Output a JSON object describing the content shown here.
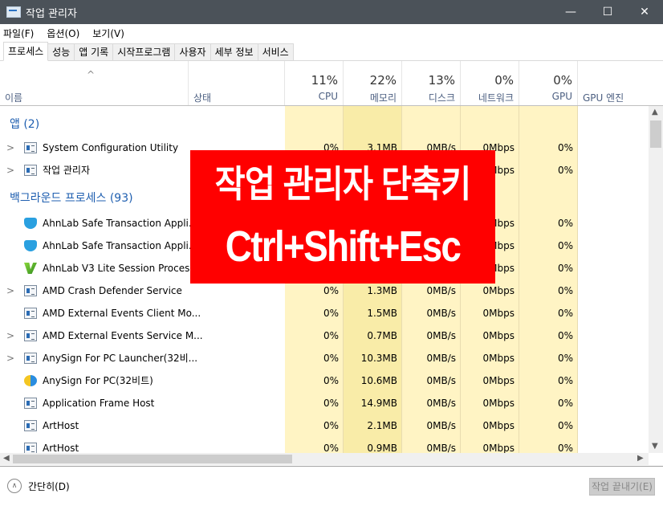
{
  "window": {
    "title": "작업 관리자",
    "minimize": "—",
    "maximize": "☐",
    "close": "✕"
  },
  "menu": [
    "파일(F)",
    "옵션(O)",
    "보기(V)"
  ],
  "tabs": [
    "프로세스",
    "성능",
    "앱 기록",
    "시작프로그램",
    "사용자",
    "세부 정보",
    "서비스"
  ],
  "active_tab": "프로세스",
  "columns": {
    "name": "이름",
    "status": "상태",
    "cpu": {
      "pct": "11%",
      "label": "CPU"
    },
    "memory": {
      "pct": "22%",
      "label": "메모리"
    },
    "disk": {
      "pct": "13%",
      "label": "디스크"
    },
    "network": {
      "pct": "0%",
      "label": "네트워크"
    },
    "gpu": {
      "pct": "0%",
      "label": "GPU"
    },
    "gpu_engine": "GPU 엔진"
  },
  "groups": {
    "apps": "앱 (2)",
    "background": "백그라운드 프로세스 (93)"
  },
  "rows": [
    {
      "name": "System Configuration Utility",
      "icon": "msconfig-icon",
      "expand": true,
      "cpu": "0%",
      "mem": "3.1MB",
      "disk": "0MB/s",
      "net": "0Mbps",
      "gpu": "0%"
    },
    {
      "name": "작업 관리자",
      "icon": "task-manager-icon",
      "expand": true,
      "cpu": "",
      "mem": "",
      "disk": "",
      "net": "Mbps",
      "gpu": "0%"
    },
    {
      "name": "AhnLab Safe Transaction Appli...",
      "icon": "shield-icon",
      "expand": false,
      "cpu": "",
      "mem": "",
      "disk": "",
      "net": "Mbps",
      "gpu": "0%"
    },
    {
      "name": "AhnLab Safe Transaction Appli...",
      "icon": "shield-icon",
      "expand": false,
      "cpu": "",
      "mem": "",
      "disk": "",
      "net": "Mbps",
      "gpu": "0%"
    },
    {
      "name": "AhnLab V3 Lite Session Proces...",
      "icon": "v3-icon",
      "expand": false,
      "cpu": "",
      "mem": "",
      "disk": "",
      "net": "Mbps",
      "gpu": "0%"
    },
    {
      "name": "AMD Crash Defender Service",
      "icon": "service-icon",
      "expand": true,
      "cpu": "0%",
      "mem": "1.3MB",
      "disk": "0MB/s",
      "net": "0Mbps",
      "gpu": "0%"
    },
    {
      "name": "AMD External Events Client Mo...",
      "icon": "service-icon",
      "expand": false,
      "cpu": "0%",
      "mem": "1.5MB",
      "disk": "0MB/s",
      "net": "0Mbps",
      "gpu": "0%"
    },
    {
      "name": "AMD External Events Service M...",
      "icon": "service-icon",
      "expand": true,
      "cpu": "0%",
      "mem": "0.7MB",
      "disk": "0MB/s",
      "net": "0Mbps",
      "gpu": "0%"
    },
    {
      "name": "AnySign For PC Launcher(32비...",
      "icon": "service-icon",
      "expand": true,
      "cpu": "0%",
      "mem": "10.3MB",
      "disk": "0MB/s",
      "net": "0Mbps",
      "gpu": "0%"
    },
    {
      "name": "AnySign For PC(32비트)",
      "icon": "anysign-icon",
      "expand": false,
      "cpu": "0%",
      "mem": "10.6MB",
      "disk": "0MB/s",
      "net": "0Mbps",
      "gpu": "0%"
    },
    {
      "name": "Application Frame Host",
      "icon": "service-icon",
      "expand": false,
      "cpu": "0%",
      "mem": "14.9MB",
      "disk": "0MB/s",
      "net": "0Mbps",
      "gpu": "0%"
    },
    {
      "name": "ArtHost",
      "icon": "service-icon",
      "expand": false,
      "cpu": "0%",
      "mem": "2.1MB",
      "disk": "0MB/s",
      "net": "0Mbps",
      "gpu": "0%"
    },
    {
      "name": "ArtHost",
      "icon": "service-icon",
      "expand": false,
      "cpu": "0%",
      "mem": "0.9MB",
      "disk": "0MB/s",
      "net": "0Mbps",
      "gpu": "0%"
    }
  ],
  "footer": {
    "fewer_details": "간단히(D)",
    "end_task": "작업 끝내기(E)"
  },
  "overlay": {
    "line1": "작업 관리자 단축키",
    "line2": "Ctrl+Shift+Esc"
  },
  "colors": {
    "titlebar": "#4b5259",
    "heat_light": "#fff4c4",
    "heat_mid": "#f9eca8",
    "group_text": "#1f5fb0",
    "overlay": "#ff0000"
  }
}
